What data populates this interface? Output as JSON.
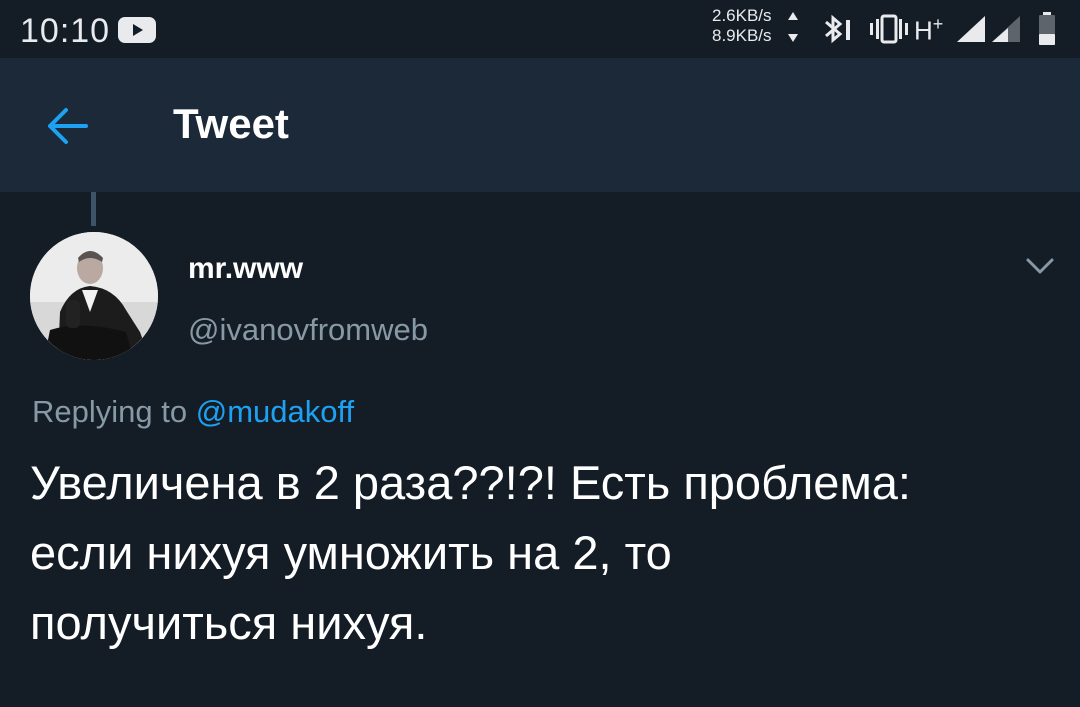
{
  "status_bar": {
    "time": "10:10",
    "net_up": "2.6KB/s",
    "net_down": "8.9KB/s",
    "network_type": "H",
    "network_type_sup": "+",
    "icons": [
      "youtube-icon",
      "bluetooth-icon",
      "vibrate-icon",
      "signal-icon",
      "signal-icon",
      "battery-icon"
    ]
  },
  "app_bar": {
    "title": "Tweet",
    "back_icon": "arrow-left-icon"
  },
  "tweet": {
    "author": {
      "display_name": "mr.www",
      "handle": "@ivanovfromweb"
    },
    "replying_to_label": "Replying to",
    "replying_to_handle": "@mudakoff",
    "text": "Увеличена в 2 раза??!?! Есть проблема:\nесли нихуя умножить на 2, то\nполучиться нихуя."
  },
  "colors": {
    "background": "#141d26",
    "app_bar": "#1c2938",
    "accent": "#1da1f2",
    "secondary_text": "#8899a6"
  }
}
